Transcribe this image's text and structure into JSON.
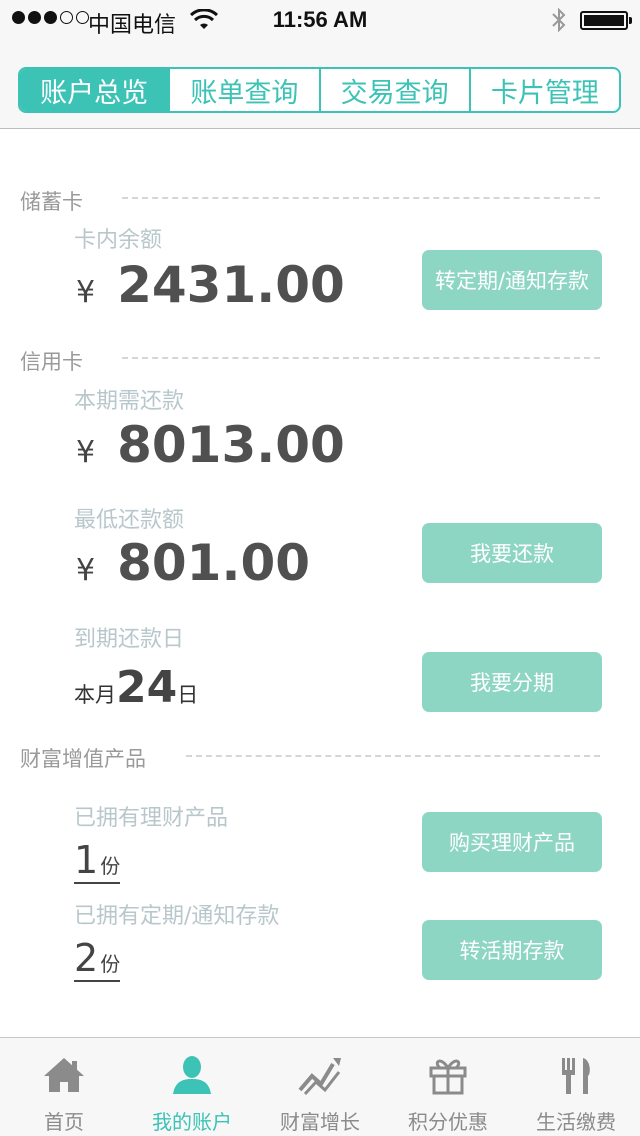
{
  "status_bar": {
    "carrier": "中国电信",
    "time": "11:56 AM"
  },
  "tabs": [
    {
      "label": "账户总览",
      "active": true
    },
    {
      "label": "账单查询",
      "active": false
    },
    {
      "label": "交易查询",
      "active": false
    },
    {
      "label": "卡片管理",
      "active": false
    }
  ],
  "savings": {
    "section": "储蓄卡",
    "balance_label": "卡内余额",
    "currency": "¥",
    "balance": "2431.00",
    "action": "转定期/通知存款"
  },
  "credit": {
    "section": "信用卡",
    "due_label": "本期需还款",
    "currency": "¥",
    "due_amount": "8013.00",
    "min_label": "最低还款额",
    "min_amount": "801.00",
    "repay_action": "我要还款",
    "due_date_label": "到期还款日",
    "due_date_prefix": "本月",
    "due_date_day": "24",
    "due_date_suffix": "日",
    "installment_action": "我要分期"
  },
  "wealth": {
    "section": "财富增值产品",
    "products_label": "已拥有理财产品",
    "products_count": "1",
    "products_unit": "份",
    "buy_action": "购买理财产品",
    "deposits_label": "已拥有定期/通知存款",
    "deposits_count": "2",
    "deposits_unit": "份",
    "convert_action": "转活期存款"
  },
  "tabbar": [
    {
      "label": "首页",
      "icon": "home-icon"
    },
    {
      "label": "我的账户",
      "icon": "user-icon",
      "active": true
    },
    {
      "label": "财富增长",
      "icon": "growth-chart-icon"
    },
    {
      "label": "积分优惠",
      "icon": "gift-icon"
    },
    {
      "label": "生活缴费",
      "icon": "fork-knife-icon"
    }
  ],
  "colors": {
    "accent": "#3cc3b6",
    "button": "#8ed6c4",
    "label": "#b8c7cb"
  }
}
